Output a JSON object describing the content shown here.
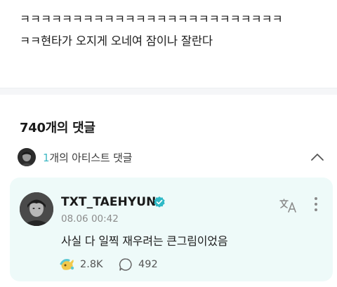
{
  "post": {
    "text": "ㅋㅋㅋㅋㅋㅋㅋㅋㅋㅋㅋㅋㅋㅋㅋㅋㅋㅋㅋㅋㅋㅋㅋㅋㅋ\nㅋㅋ현타가 오지게 오네여 잠이나 잘란다"
  },
  "comments": {
    "count_label": "740개의 댓글",
    "artist_section": {
      "count": "1",
      "label": "개의 아티스트 댓글",
      "icon": "chevron-up-icon"
    }
  },
  "artist_comment": {
    "username": "TXT_TAEHYUN",
    "timestamp": "08.06 00:42",
    "text": "사실 다 일찍 재우려는 큰그림이었음",
    "likes": "2.8K",
    "replies": "492",
    "icons": {
      "verified": "verified-badge-icon",
      "translate": "translate-icon",
      "more": "more-vertical-icon",
      "like": "like-icon",
      "reply": "reply-icon"
    }
  },
  "colors": {
    "accent": "#3fb8c4",
    "card_background": "#eefaf9",
    "verified": "#2fb9c6"
  }
}
